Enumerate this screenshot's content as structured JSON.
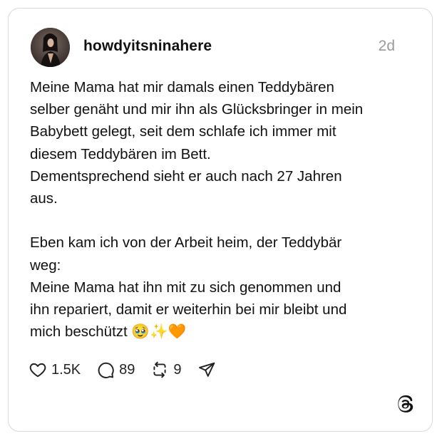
{
  "post": {
    "username": "howdyitsninahere",
    "timestamp": "2d",
    "paragraph_1": "Meine Mama hat mir damals einen Teddybären\nselber genäht und mir ihn als Glücksbringer in mein\nBabybett gelegt, seit dem schlafe ich immer mit\ndiesem Teddybären im Bett.\nDementsprechend sieht er auch nach 27 Jahren\naus.",
    "paragraph_2": "Eben kam ich von der Arbeit heim, der Teddybär\nweg:\nMeine Mama hat ihn mit zu sich genommen und\nihn repariert, damit er weiterhin bei mir bleibt und\nmich beschützt 🥹✨🧡"
  },
  "actions": {
    "like_count": "1.5K",
    "reply_count": "89",
    "repost_count": "9"
  },
  "icons": {
    "like": "heart-icon",
    "reply": "comment-bubble-icon",
    "repost": "repost-icon",
    "share": "send-icon",
    "brand": "threads-logo-icon"
  },
  "colors": {
    "text": "#111111",
    "muted": "#9a9a9a",
    "border": "#d9d9d9"
  }
}
